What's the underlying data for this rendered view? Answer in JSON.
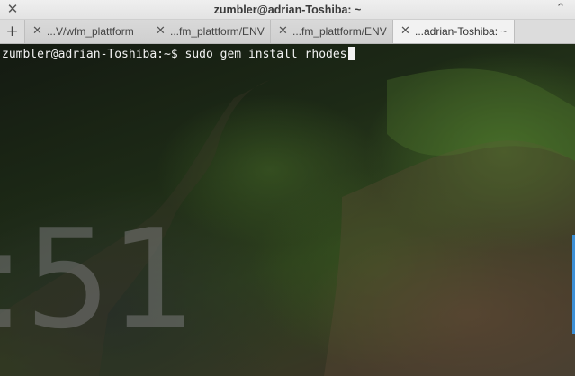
{
  "window": {
    "title": "zumbler@adrian-Toshiba: ~",
    "close_glyph": "✕",
    "maximize_glyph": "⌃"
  },
  "tabbar": {
    "new_tab_glyph": "+",
    "tabs": [
      {
        "label": "...V/wfm_plattform",
        "active": false,
        "close_glyph": "✕"
      },
      {
        "label": "...fm_plattform/ENV",
        "active": false,
        "close_glyph": "✕"
      },
      {
        "label": "...fm_plattform/ENV",
        "active": false,
        "close_glyph": "✕"
      },
      {
        "label": "...adrian-Toshiba: ~",
        "active": true,
        "close_glyph": "✕"
      }
    ]
  },
  "terminal": {
    "prompt": "zumbler@adrian-Toshiba:~$ ",
    "command": "sudo gem install rhodes"
  },
  "wallpaper": {
    "clock_text": ":51"
  },
  "icons": {
    "close": "close-icon",
    "maximize": "maximize-icon",
    "new_tab": "plus-icon",
    "tab_close": "close-icon"
  },
  "colors": {
    "titlebar": "#e9e9e9",
    "active_tab": "#f2f2f2",
    "terminal_text": "#f2f2f2",
    "scroll_accent": "#3c8fd6"
  }
}
